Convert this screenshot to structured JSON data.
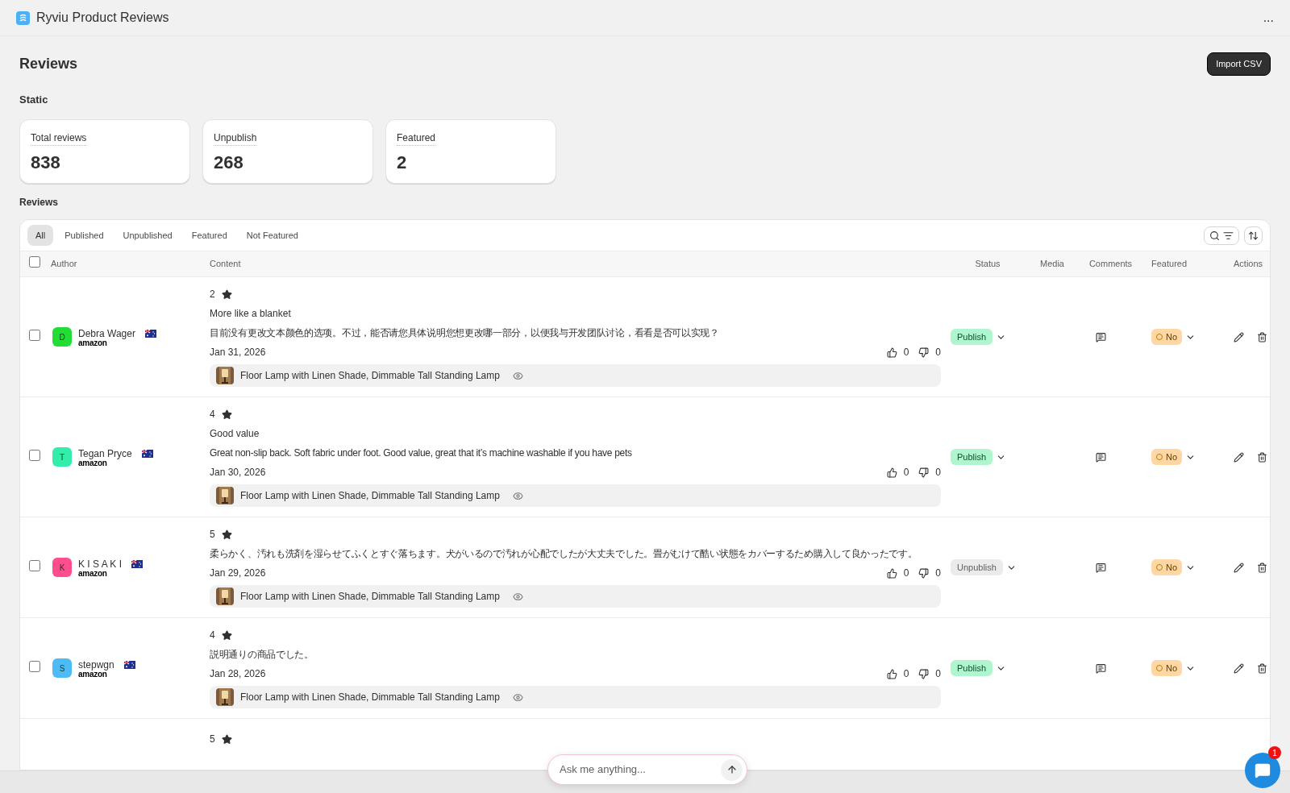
{
  "app": {
    "title": "Ryviu Product Reviews",
    "menu": "..."
  },
  "page": {
    "title": "Reviews",
    "import_button": "Import CSV"
  },
  "stats": {
    "heading": "Static",
    "cards": [
      {
        "label": "Total reviews",
        "value": "838"
      },
      {
        "label": "Unpublish",
        "value": "268"
      },
      {
        "label": "Featured",
        "value": "2"
      }
    ]
  },
  "reviews": {
    "heading": "Reviews",
    "tabs": [
      {
        "label": "All",
        "selected": true
      },
      {
        "label": "Published",
        "selected": false
      },
      {
        "label": "Unpublished",
        "selected": false
      },
      {
        "label": "Featured",
        "selected": false
      },
      {
        "label": "Not Featured",
        "selected": false
      }
    ],
    "columns": [
      "Author",
      "Content",
      "Status",
      "Media",
      "Comments",
      "Featured",
      "Actions"
    ],
    "select_all": {
      "checked": false
    },
    "rows": [
      {
        "checked": false,
        "initial": "D",
        "color": "#22dd33",
        "name": "Debra Wager",
        "source": "amazon",
        "rating": "2",
        "title": "More like a blanket",
        "body": "目前没有更改文本颜色的选项。不过，能否请您具体说明您想更改哪一部分，以便我与开发团队讨论，看看是否可以实现？",
        "date": "Jan 31, 2026",
        "likes": "0",
        "dislikes": "0",
        "product": "Floor Lamp with Linen Shade, Dimmable Tall Standing Lamp",
        "status": "Publish",
        "published": true,
        "featured": "No"
      },
      {
        "checked": false,
        "initial": "T",
        "color": "#33eeaa",
        "name": "Tegan Pryce",
        "source": "amazon",
        "rating": "4",
        "title": "Good value",
        "body": "Great non-slip back. Soft fabric under foot. Good value, great that it’s machine washable if you have pets",
        "date": "Jan 30, 2026",
        "likes": "0",
        "dislikes": "0",
        "product": "Floor Lamp with Linen Shade, Dimmable Tall Standing Lamp",
        "status": "Publish",
        "published": true,
        "featured": "No"
      },
      {
        "checked": false,
        "initial": "K",
        "color": "#ff4d8d",
        "name": "K I S A K I",
        "source": "amazon",
        "rating": "5",
        "body": "柔らかく、汚れも洗剤を湿らせてふくとすぐ落ちます。犬がいるので汚れが心配でしたが大丈夫でした。畳がむけて酷い状態をカバーするため購入して良かったです。",
        "date": "Jan 29, 2026",
        "likes": "0",
        "dislikes": "0",
        "product": "Floor Lamp with Linen Shade, Dimmable Tall Standing Lamp",
        "status": "Unpublish",
        "published": false,
        "featured": "No"
      },
      {
        "checked": false,
        "initial": "S",
        "color": "#4dbbf5",
        "name": "stepwgn",
        "source": "amazon",
        "rating": "4",
        "body": "説明通りの商品でした。",
        "date": "Jan 28, 2026",
        "likes": "0",
        "dislikes": "0",
        "product": "Floor Lamp with Linen Shade, Dimmable Tall Standing Lamp",
        "status": "Publish",
        "published": true,
        "featured": "No"
      },
      {
        "rating": "5"
      }
    ]
  },
  "assistant": {
    "placeholder": "Ask me anything...",
    "badge": "1"
  }
}
